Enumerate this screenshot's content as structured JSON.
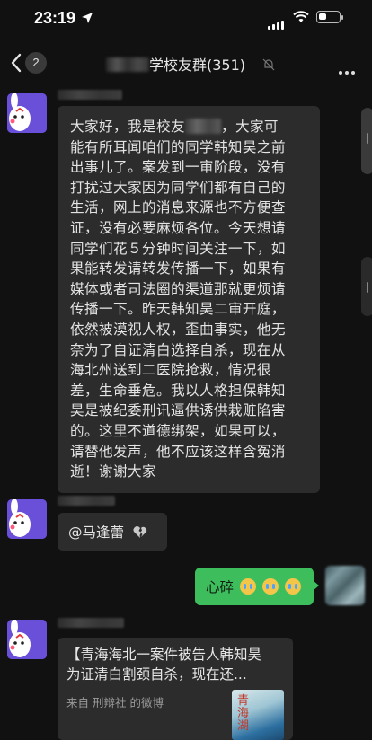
{
  "status_bar": {
    "time": "23:19"
  },
  "nav": {
    "unread_count": "2",
    "title_suffix": "学校友群(351)"
  },
  "messages": {
    "long_text_lines": [
      [
        "大家好，我是校友",
        "，大家可"
      ],
      [
        "能有所耳闻咱们的同学韩知昊之前"
      ],
      [
        "出事儿了。案发到一审阶段，没有"
      ],
      [
        "打扰过大家因为同学们都有自己的"
      ],
      [
        "生活，网上的消息来源也不方便查"
      ],
      [
        "证，没有必要麻烦各位。今天想请"
      ],
      [
        "同学们花５分钟时间关注一下，如"
      ],
      [
        "果能转发请转发传播一下，如果有"
      ],
      [
        "媒体或者司法圈的渠道那就更烦请"
      ],
      [
        "传播一下。昨天韩知昊二审开庭，"
      ],
      [
        "依然被漠视人权，歪曲事实，他无"
      ],
      [
        "奈为了自证清白选择自杀，现在从"
      ],
      [
        "海北州送到二医院抢救，情况很"
      ],
      [
        "差，生命垂危。我以人格担保韩知"
      ],
      [
        "昊是被纪委刑讯逼供诱供栽赃陷害"
      ],
      [
        "的。这里不道德绑架，如果可以，"
      ],
      [
        "请替他发声，他不应该这样含冤消"
      ],
      [
        "逝！谢谢大家"
      ]
    ],
    "mention": "@马逢蕾",
    "mine": "心碎",
    "card": {
      "title_line1": "【青海海北一案件被告人韩知昊",
      "title_line2": "为证清白割颈自杀，现在还...",
      "source": "来自  刑辩社  的微博",
      "thumb_text": "青海湖"
    }
  },
  "colors": {
    "background": "#111111",
    "bubble_other": "#2c2c2c",
    "bubble_mine": "#3ebd5c",
    "avatar": "#6a4fd8"
  }
}
